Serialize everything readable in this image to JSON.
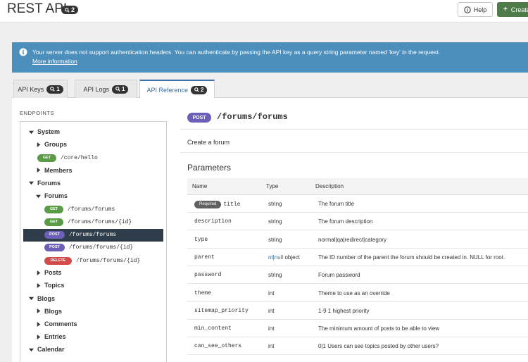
{
  "header": {
    "title": "REST API",
    "title_count": "2",
    "help_label": "Help",
    "create_label": "Create"
  },
  "banner": {
    "message": "Your server does not support authentication headers. You can authenticate by passing the API key as a query string parameter named 'key' in the request.",
    "more_link": "More information"
  },
  "tabs": [
    {
      "label": "API Keys",
      "count": "1"
    },
    {
      "label": "API Logs",
      "count": "1"
    },
    {
      "label": "API Reference",
      "count": "2"
    }
  ],
  "sidebar": {
    "title": "ENDPOINTS",
    "tree": [
      {
        "label": "System",
        "level": 0,
        "expanded": true
      },
      {
        "label": "Groups",
        "level": 1,
        "expanded": false
      },
      {
        "method": "GET",
        "path": "/core/hello",
        "level": 1
      },
      {
        "label": "Members",
        "level": 1,
        "expanded": false
      },
      {
        "label": "Forums",
        "level": 0,
        "expanded": true
      },
      {
        "label": "Forums",
        "level": 1,
        "expanded": true
      },
      {
        "method": "GET",
        "path": "/forums/forums",
        "level": 2
      },
      {
        "method": "GET",
        "path": "/forums/forums/{id}",
        "level": 2
      },
      {
        "method": "POST",
        "path": "/forums/forums",
        "level": 2,
        "selected": true
      },
      {
        "method": "POST",
        "path": "/forums/forums/{id}",
        "level": 2
      },
      {
        "method": "DELETE",
        "path": "/forums/forums/{id}",
        "level": 2
      },
      {
        "label": "Posts",
        "level": 1,
        "expanded": false
      },
      {
        "label": "Topics",
        "level": 1,
        "expanded": false
      },
      {
        "label": "Blogs",
        "level": 0,
        "expanded": true
      },
      {
        "label": "Blogs",
        "level": 1,
        "expanded": false
      },
      {
        "label": "Comments",
        "level": 1,
        "expanded": false
      },
      {
        "label": "Entries",
        "level": 1,
        "expanded": false
      },
      {
        "label": "Calendar",
        "level": 0,
        "expanded": true
      }
    ]
  },
  "endpoint": {
    "method": "POST",
    "path": "/forums/forums",
    "description": "Create a forum",
    "params_heading": "Parameters",
    "columns": [
      "Name",
      "Type",
      "Description"
    ],
    "required_label": "Required",
    "params": [
      {
        "name": "title",
        "type": "string",
        "description": "The forum title",
        "required": true
      },
      {
        "name": "description",
        "type": "string",
        "description": "The forum description"
      },
      {
        "name": "type",
        "type": "string",
        "description": "normal|qa|redirect|category"
      },
      {
        "name": "parent",
        "type_link": "nt|null",
        "type": "object",
        "description": "The ID number of the parent the forum should be created in. NULL for root."
      },
      {
        "name": "password",
        "type": "string",
        "description": "Forum password"
      },
      {
        "name": "theme",
        "type": "int",
        "description": "Theme to use as an override"
      },
      {
        "name": "sitemap_priority",
        "type": "int",
        "description": "1-9 1 highest priority"
      },
      {
        "name": "min_content",
        "type": "int",
        "description": "The minimum amount of posts to be able to view"
      },
      {
        "name": "can_see_others",
        "type": "int",
        "description": "0|1 Users can see topics posted by other users?"
      }
    ]
  },
  "colors": {
    "banner": "#4c8fbd",
    "get": "#5a9b46",
    "post": "#6b5fb8",
    "delete": "#d34a4a",
    "selected": "#2f3c4a",
    "create": "#4f7b4a",
    "active_tab": "#3b6fa5"
  }
}
